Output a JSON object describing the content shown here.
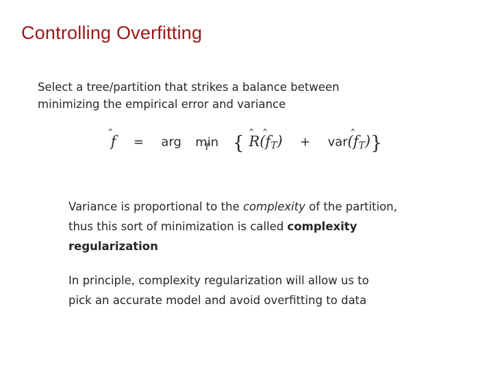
{
  "slide": {
    "title": "Controlling Overfitting",
    "title_color": "#9E1515",
    "body_color": "#262626",
    "background_color": "#FFFFFF"
  },
  "intro_paragraph": {
    "line1": "Select a tree/partition that strikes a balance between",
    "line2": "minimizing the empirical error and variance",
    "full_text": "Select a tree/partition that strikes a balance between minimizing the empirical error and variance"
  },
  "equation": {
    "plain_text": "f̂ = arg min_T { R̂(f̂_T) + var(f̂_T) }",
    "lhs_symbol": "f",
    "lhs_hat": "̂",
    "equals": "=",
    "arg_label": "arg",
    "min_label": "min",
    "min_subscript": "T",
    "open_brace": "{",
    "risk_symbol": "R",
    "risk_hat": "̂",
    "risk_open_paren": "(",
    "risk_arg_symbol": "f",
    "risk_arg_hat": "̂",
    "risk_arg_subscript": "T",
    "risk_close_paren": ")",
    "plus": "+",
    "var_label": "var",
    "var_open_paren": "(",
    "var_arg_symbol": "f",
    "var_arg_hat": "̂",
    "var_arg_subscript": "T",
    "var_close_paren": ")",
    "close_brace": "}"
  },
  "variance_paragraph": {
    "seg1": "Variance is proportional to the ",
    "seg2_italic": "complexity",
    "seg3": " of the partition, thus this sort of minimization is called ",
    "seg4_bold": "complexity regularization",
    "full_text": "Variance is proportional to the complexity of the partition, thus this sort of minimization is called complexity regularization"
  },
  "principle_paragraph": {
    "text": "In principle, complexity regularization will allow us to pick an accurate model and avoid overfitting to data"
  }
}
